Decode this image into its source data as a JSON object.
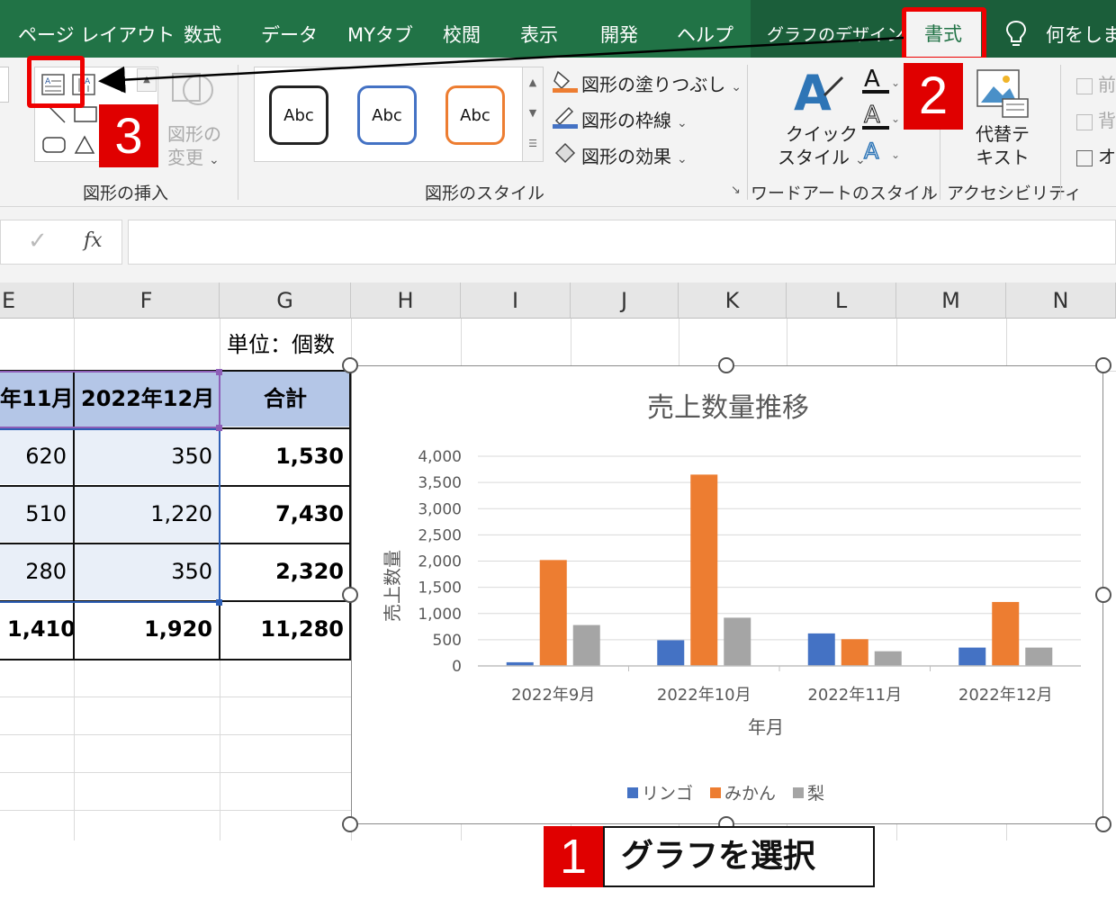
{
  "tabs": [
    {
      "label": "ページ レイアウト",
      "active": false
    },
    {
      "label": "数式",
      "active": false
    },
    {
      "label": "データ",
      "active": false
    },
    {
      "label": "MYタブ",
      "active": false
    },
    {
      "label": "校閲",
      "active": false
    },
    {
      "label": "表示",
      "active": false
    },
    {
      "label": "開発",
      "active": false
    },
    {
      "label": "ヘルプ",
      "active": false
    },
    {
      "label": "グラフのデザイン",
      "active": false
    },
    {
      "label": "書式",
      "active": true
    }
  ],
  "tell_me": "何をします",
  "ribbon": {
    "insert_shapes": {
      "label": "図形の挿入",
      "change_shape": "図形の変更",
      "change_shape_line1": "図形の",
      "change_shape_line2": "変更"
    },
    "shape_styles": {
      "label": "図形のスタイル",
      "presets": [
        {
          "text": "Abc",
          "color": "#222222"
        },
        {
          "text": "Abc",
          "color": "#4472c4"
        },
        {
          "text": "Abc",
          "color": "#ed7d31"
        }
      ],
      "fill": "図形の塗りつぶし",
      "outline": "図形の枠線",
      "effects": "図形の効果"
    },
    "wordart": {
      "label": "ワードアートのスタイル",
      "quick_line1": "クイック",
      "quick_line2": "スタイル"
    },
    "accessibility": {
      "label": "アクセシビリティ",
      "alt_line1": "代替テ",
      "alt_line2": "キスト"
    },
    "arrange": {
      "item1": "前",
      "item2": "背",
      "item3": "オ"
    }
  },
  "formula_bar": {
    "fx": "fx",
    "check": "✓",
    "value": ""
  },
  "columns": [
    "E",
    "F",
    "G",
    "H",
    "I",
    "J",
    "K",
    "L",
    "M",
    "N"
  ],
  "sheet": {
    "unit_note": "単位：個数",
    "headers": [
      "年11月",
      "2022年12月",
      "合計"
    ],
    "rows": [
      [
        "620",
        "350",
        "1,530"
      ],
      [
        "510",
        "1,220",
        "7,430"
      ],
      [
        "280",
        "350",
        "2,320"
      ],
      [
        "1,410",
        "1,920",
        "11,280"
      ]
    ]
  },
  "chart_data": {
    "type": "bar",
    "title": "売上数量推移",
    "xlabel": "年月",
    "ylabel": "売上数量",
    "categories": [
      "2022年9月",
      "2022年10月",
      "2022年11月",
      "2022年12月"
    ],
    "series": [
      {
        "name": "リンゴ",
        "color": "#4472c4",
        "values": [
          70,
          490,
          620,
          350
        ]
      },
      {
        "name": "みかん",
        "color": "#ed7d31",
        "values": [
          2020,
          3650,
          510,
          1220
        ]
      },
      {
        "name": "梨",
        "color": "#a5a5a5",
        "values": [
          780,
          920,
          280,
          350
        ]
      }
    ],
    "ylim": [
      0,
      4000
    ],
    "yticks": [
      0,
      500,
      1000,
      1500,
      2000,
      2500,
      3000,
      3500,
      4000
    ],
    "ytick_labels": [
      "0",
      "500",
      "1,000",
      "1,500",
      "2,000",
      "2,500",
      "3,000",
      "3,500",
      "4,000"
    ],
    "grid": true,
    "legend": "bottom"
  },
  "annotations": {
    "step1_num": "1",
    "step1_text": "グラフを選択",
    "step2_num": "2",
    "step3_num": "3"
  },
  "colors": {
    "ribbon_green": "#217346",
    "highlight_red": "#ee0000",
    "header_fill": "#b4c6e7",
    "data_fill": "#e9eff8"
  }
}
